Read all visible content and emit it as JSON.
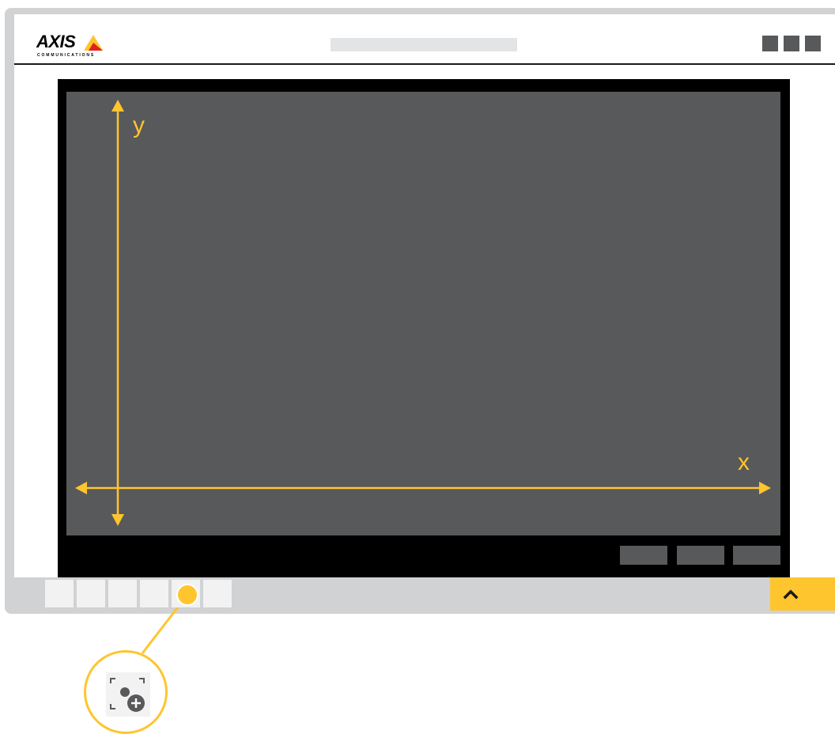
{
  "brand": {
    "name": "AXIS",
    "tagline": "COMMUNICATIONS",
    "accent_color": "#fec52e",
    "logo_red": "#e32119"
  },
  "header": {
    "search_placeholder": "",
    "window_controls": [
      "window-control-1",
      "window-control-2",
      "window-control-3"
    ]
  },
  "video": {
    "x_label": "x",
    "y_label": "y",
    "background_color": "#58595b"
  },
  "toolbar": {
    "tools": [
      "tool-1",
      "tool-2",
      "tool-3",
      "tool-4",
      "tool-5-add-point",
      "tool-6"
    ],
    "expand_icon": "chevron-up-icon"
  },
  "callout": {
    "icon": "add-area-icon"
  }
}
